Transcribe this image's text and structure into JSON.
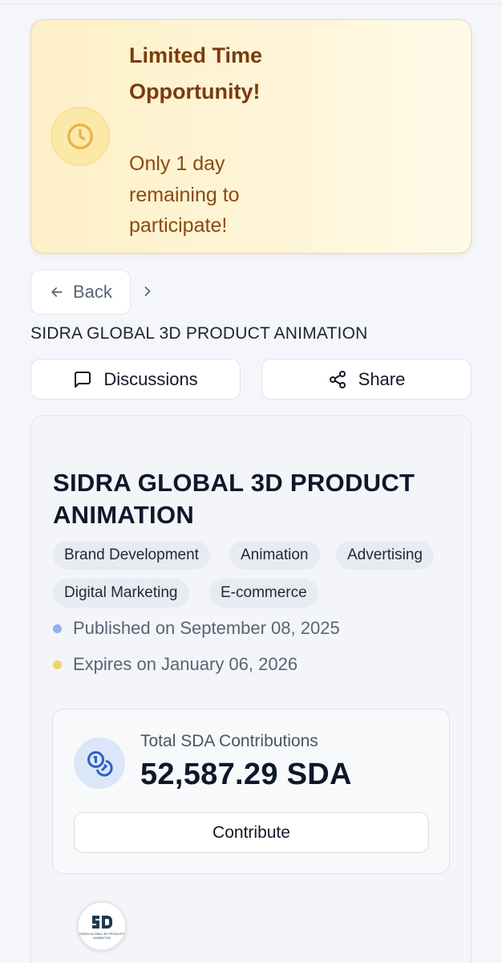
{
  "banner": {
    "title": "Limited Time Opportunity!",
    "subtitle": "Only 1 day remaining to participate!",
    "icon": "clock-icon"
  },
  "nav": {
    "back_label": "Back",
    "breadcrumb_title": "SIDRA GLOBAL 3D PRODUCT ANIMATION"
  },
  "actions": {
    "discussions_label": "Discussions",
    "share_label": "Share"
  },
  "project": {
    "title": "SIDRA GLOBAL 3D PRODUCT ANIMATION",
    "tags": [
      "Brand Development",
      "Animation",
      "Advertising",
      "Digital Marketing",
      "E-commerce"
    ],
    "published": "Published on September 08, 2025",
    "expires": "Expires on January 06, 2026"
  },
  "contributions": {
    "label": "Total SDA Contributions",
    "value": "52,587.29 SDA",
    "button_label": "Contribute"
  },
  "logo": {
    "text": "SIDRA GLOBAL 3D PRODUCT ANIMATION"
  },
  "colors": {
    "banner_title": "#7a3b0e",
    "published_dot": "#8fb3ea",
    "expires_dot": "#f2d36b",
    "coin_blue": "#2f5fc4"
  }
}
